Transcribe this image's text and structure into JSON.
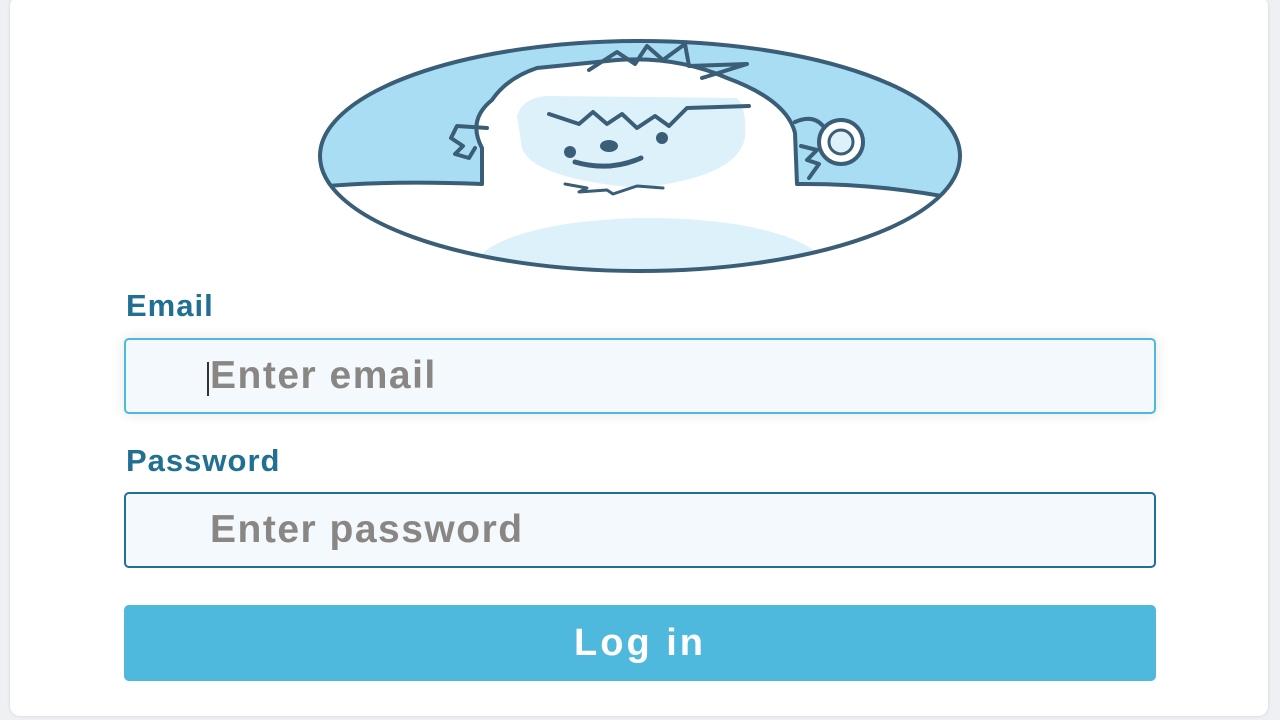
{
  "avatar": {
    "icon": "yeti-mascot-icon",
    "colors": {
      "background": "#a9ddf3",
      "outline": "#3a5e77",
      "body": "#ffffff",
      "face": "#ddf1fa"
    }
  },
  "form": {
    "email": {
      "label": "Email",
      "placeholder": "Enter email",
      "value": ""
    },
    "password": {
      "label": "Password",
      "placeholder": "Enter password",
      "value": ""
    },
    "submit_label": "Log in"
  },
  "colors": {
    "label": "#217093",
    "accent": "#4eb8dd",
    "input_background": "#f3f9fc",
    "placeholder": "#8a8683"
  }
}
